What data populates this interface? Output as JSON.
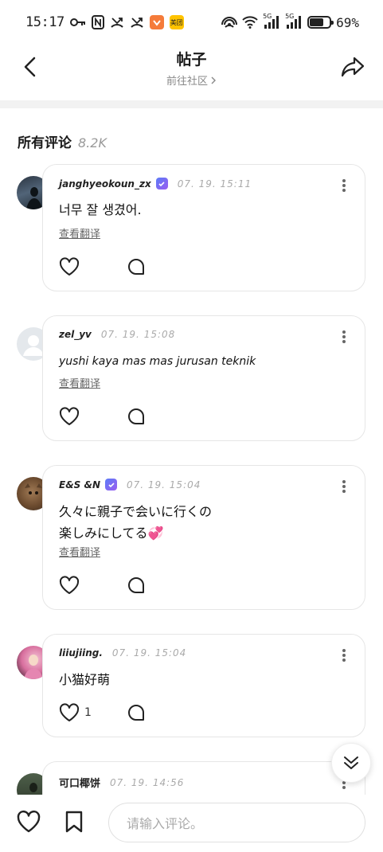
{
  "status_bar": {
    "time": "15:17",
    "network_1": "5G",
    "network_2": "5G",
    "battery": "69%",
    "battery_level": 0.69,
    "app_badge": "美团"
  },
  "header": {
    "title": "帖子",
    "subtitle": "前往社区"
  },
  "section": {
    "title": "所有评论",
    "count": "8.2K"
  },
  "translate_label": "查看翻译",
  "comments": [
    {
      "username": "janghyeokoun_zx",
      "verified": true,
      "timestamp": "07. 19. 15:11",
      "text": "너무 잘 생겼어.",
      "likes": ""
    },
    {
      "username": "zel_yv",
      "verified": false,
      "timestamp": "07. 19. 15:08",
      "text": "yushi kaya mas mas jurusan teknik",
      "likes": ""
    },
    {
      "username": "E&S &N",
      "verified": true,
      "timestamp": "07. 19. 15:04",
      "text_line1": "久々に親子で会いに行くの",
      "text_line2": "楽しみにしてる💞",
      "likes": ""
    },
    {
      "username": "liiujiing.",
      "verified": false,
      "timestamp": "07. 19. 15:04",
      "text": "小猫好萌",
      "likes": "1"
    },
    {
      "username": "可口椰饼",
      "verified": false,
      "timestamp": "07. 19. 14:56",
      "text": "",
      "likes": ""
    }
  ],
  "bottom_bar": {
    "input_placeholder": "请输入评论。"
  },
  "colors": {
    "verify_badge": "#7b6cf4",
    "divider": "#f2f2f2",
    "card_border": "#e6e6e6"
  }
}
